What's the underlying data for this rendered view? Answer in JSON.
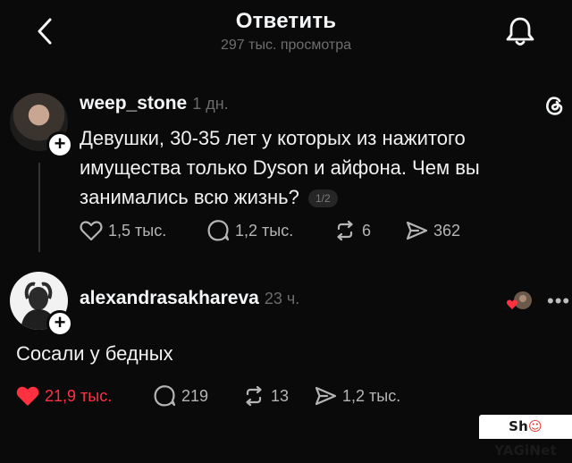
{
  "header": {
    "title": "Ответить",
    "subtitle": "297 тыс. просмотра",
    "back_icon": "chevron-left-icon",
    "bell_icon": "bell-icon"
  },
  "post": {
    "username": "weep_stone",
    "time": "1 дн.",
    "text": "Девушки,  30-35 лет у которых из нажитого имущества только Dyson и  айфона. Чем вы занимались всю жизнь?",
    "pager": "1/2",
    "likes": "1,5 тыс.",
    "comments": "1,2 тыс.",
    "reposts": "6",
    "shares": "362"
  },
  "reply": {
    "username": "alexandrasakhareva",
    "time": "23 ч.",
    "text": "Сосали у бедных",
    "likes": "21,9 тыс.",
    "comments": "219",
    "reposts": "13",
    "shares": "1,2 тыс.",
    "more": "•••",
    "like_color": "#ff3040"
  },
  "watermark": {
    "part1": "Sh",
    "part2": "YAGiNet"
  }
}
